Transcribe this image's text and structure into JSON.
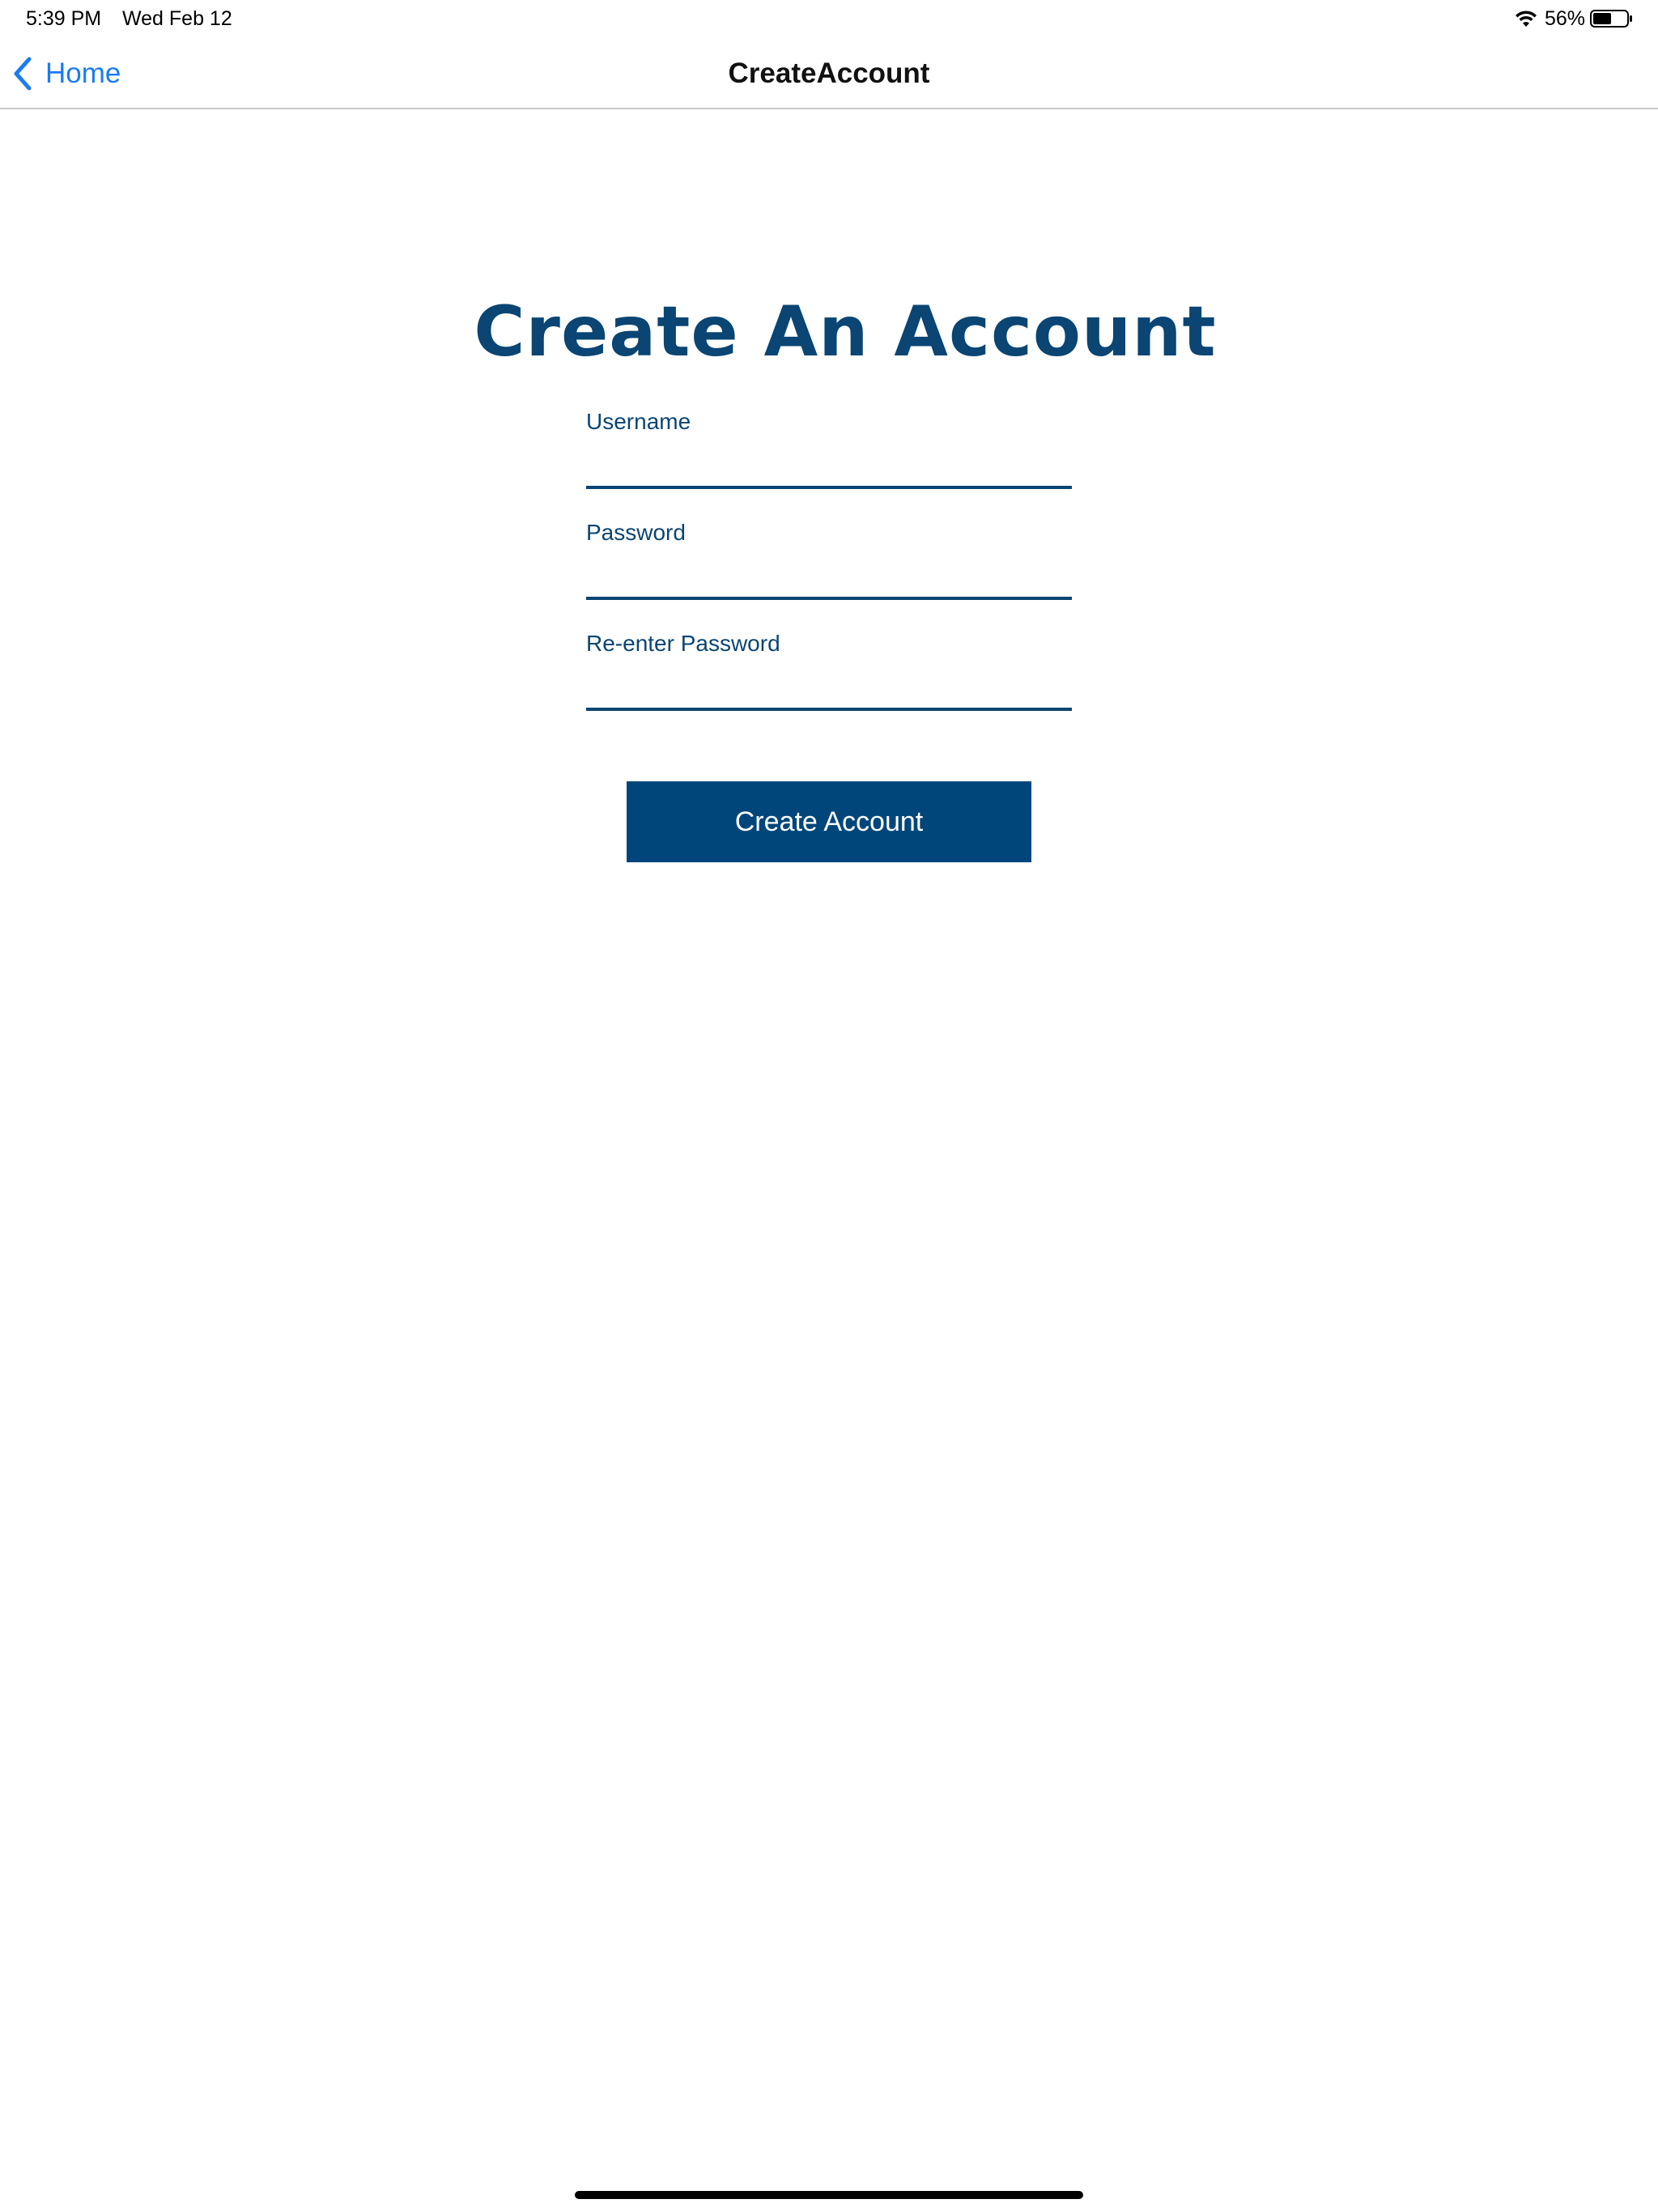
{
  "status_bar": {
    "time": "5:39 PM",
    "date": "Wed Feb 12",
    "battery_percent": "56%",
    "battery_level": 0.56,
    "icons": [
      "wifi-icon",
      "battery-icon"
    ]
  },
  "nav_bar": {
    "back_label": "Home",
    "title": "CreateAccount",
    "accent_color": "#1a7cf0"
  },
  "form": {
    "heading": "Create An Account",
    "fields": [
      {
        "label": "Username",
        "value": "",
        "placeholder": ""
      },
      {
        "label": "Password",
        "value": "",
        "placeholder": ""
      },
      {
        "label": "Re-enter Password",
        "value": "",
        "placeholder": ""
      }
    ],
    "submit_label": "Create Account",
    "brand_color": "#00467a"
  }
}
